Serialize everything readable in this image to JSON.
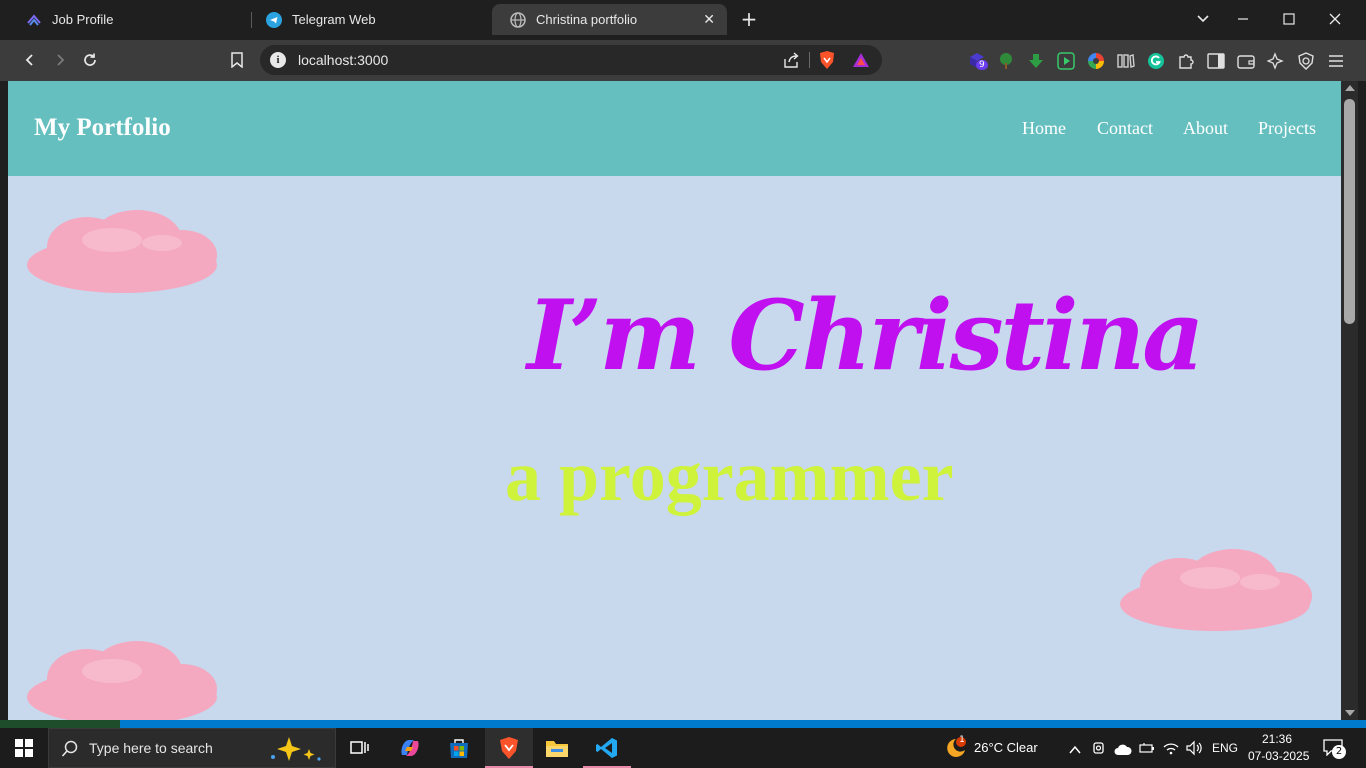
{
  "browser": {
    "tabs": [
      {
        "title": "Job Profile",
        "active": false
      },
      {
        "title": "Telegram Web",
        "active": false
      },
      {
        "title": "Christina portfolio",
        "active": true
      }
    ],
    "url": "localhost:3000",
    "extension_badge": "9"
  },
  "site": {
    "logo": "My Portfolio",
    "nav": [
      "Home",
      "Contact",
      "About",
      "Projects"
    ],
    "hero_title": "I’m Christina",
    "hero_subtitle": "a programmer",
    "colors": {
      "nav_bg": "#66bfbf",
      "page_bg": "#c8d8ed",
      "title": "#c110f0",
      "subtitle": "#cff23a",
      "cloud": "#f4a9c0"
    }
  },
  "taskbar": {
    "search_placeholder": "Type here to search",
    "weather": "26°C  Clear",
    "weather_badge": "1",
    "language": "ENG",
    "time": "21:36",
    "date": "07-03-2025",
    "notification_count": "2"
  }
}
